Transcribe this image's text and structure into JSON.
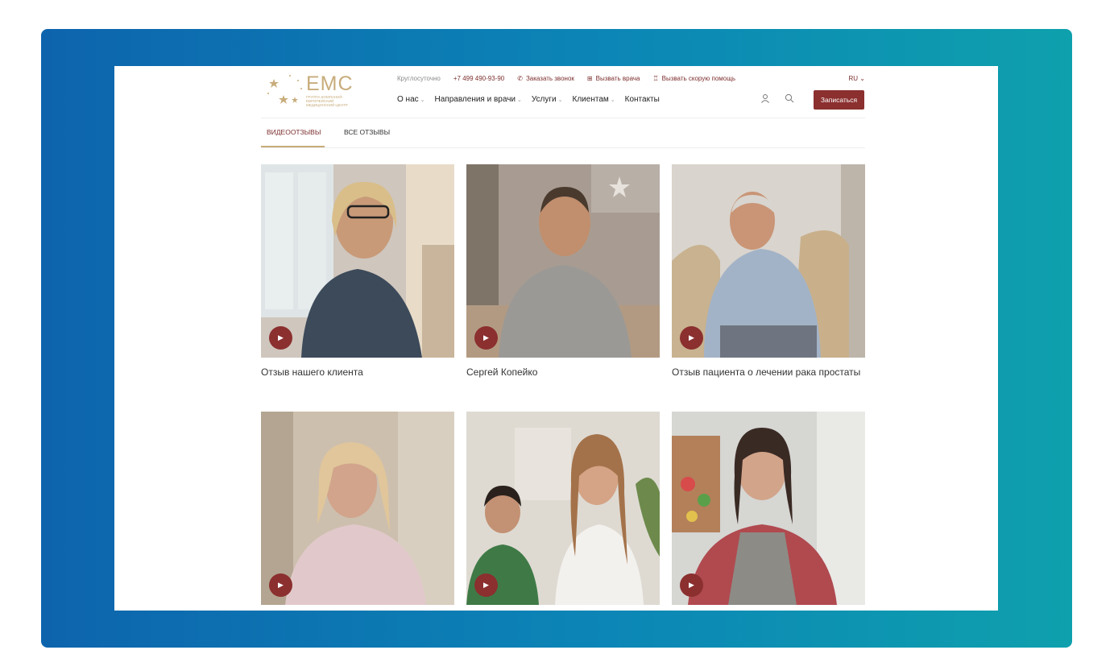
{
  "header": {
    "logo": {
      "brand": "EMC",
      "subtitle": "ГРУППА КОМПАНИЙ ЕВРОПЕЙСКИЙ МЕДИЦИНСКИЙ ЦЕНТР"
    },
    "topline": {
      "hours": "Круглосуточно",
      "phone": "+7 499 490-93-90",
      "callback": "Заказать звонок",
      "doctor": "Вызвать врача",
      "ambulance": "Вызвать скорую помощь"
    },
    "lang": "RU",
    "nav": [
      "О нас",
      "Направления и врачи",
      "Услуги",
      "Клиентам",
      "Контакты"
    ],
    "book_label": "Записаться"
  },
  "tabs": [
    "ВИДЕООТЗЫВЫ",
    "ВСЕ ОТЗЫВЫ"
  ],
  "videos": [
    {
      "title": "Отзыв нашего клиента"
    },
    {
      "title": "Сергей Копейко"
    },
    {
      "title": "Отзыв пациента о лечении рака простаты"
    },
    {
      "title": ""
    },
    {
      "title": ""
    },
    {
      "title": ""
    }
  ],
  "colors": {
    "accent": "#8b2f2f",
    "gold": "#c8ac7b",
    "frame_start": "#0d64ad",
    "frame_end": "#0ea0ad"
  }
}
